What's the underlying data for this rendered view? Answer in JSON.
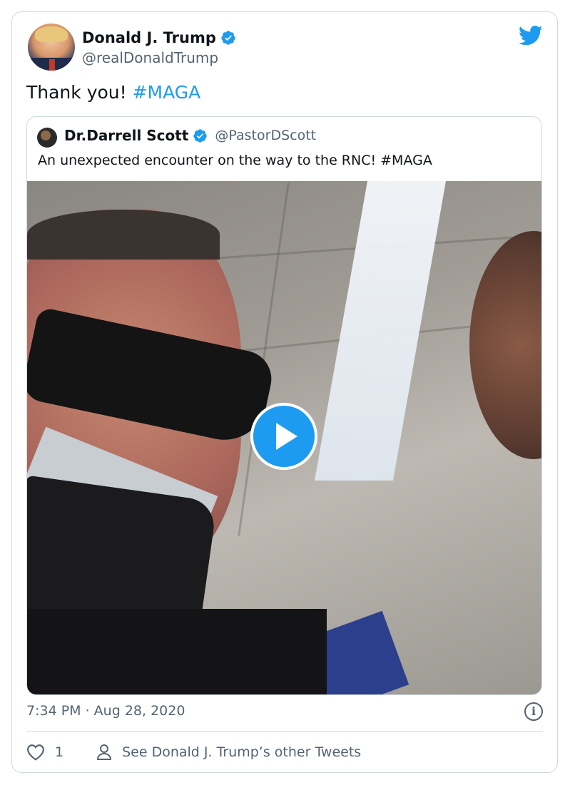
{
  "tweet": {
    "author": {
      "name": "Donald J. Trump",
      "handle": "@realDonaldTrump",
      "verified": true
    },
    "text_prefix": "Thank you! ",
    "hashtag": "#MAGA",
    "timestamp": "7:34 PM · Aug 28, 2020",
    "likes": "1",
    "other_tweets_link": "See Donald J. Trump’s other Tweets"
  },
  "quoted_tweet": {
    "author": {
      "name": "Dr.Darrell Scott",
      "handle": "@PastorDScott",
      "verified": true
    },
    "text": "An unexpected encounter on the way to the RNC! #MAGA",
    "media": {
      "type": "video",
      "play_icon": "play-icon"
    }
  },
  "icons": {
    "brand": "twitter-bird-icon",
    "verified": "verified-badge-icon",
    "info": "info-icon",
    "like": "heart-icon",
    "profile": "person-icon"
  },
  "colors": {
    "accent": "#1d9bf0",
    "secondary_text": "#536471",
    "border": "#cfd9de"
  }
}
